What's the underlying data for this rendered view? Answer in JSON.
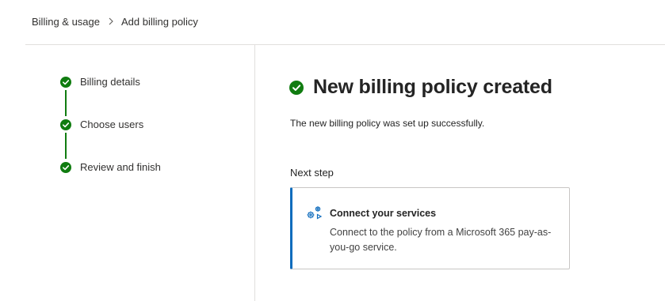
{
  "breadcrumb": {
    "items": [
      {
        "label": "Billing & usage"
      },
      {
        "label": "Add billing policy"
      }
    ]
  },
  "steps": [
    {
      "label": "Billing details",
      "status": "complete"
    },
    {
      "label": "Choose users",
      "status": "complete"
    },
    {
      "label": "Review and finish",
      "status": "complete"
    }
  ],
  "main": {
    "title": "New billing policy created",
    "message": "The new billing policy was set up successfully.",
    "next_step_label": "Next step",
    "card": {
      "title": "Connect your services",
      "description": "Connect to the policy from a Microsoft 365 pay-as-you-go service.",
      "icon": "gears-icon"
    }
  },
  "colors": {
    "success": "#107c10",
    "accent": "#0f6cbd",
    "text": "#242424"
  }
}
